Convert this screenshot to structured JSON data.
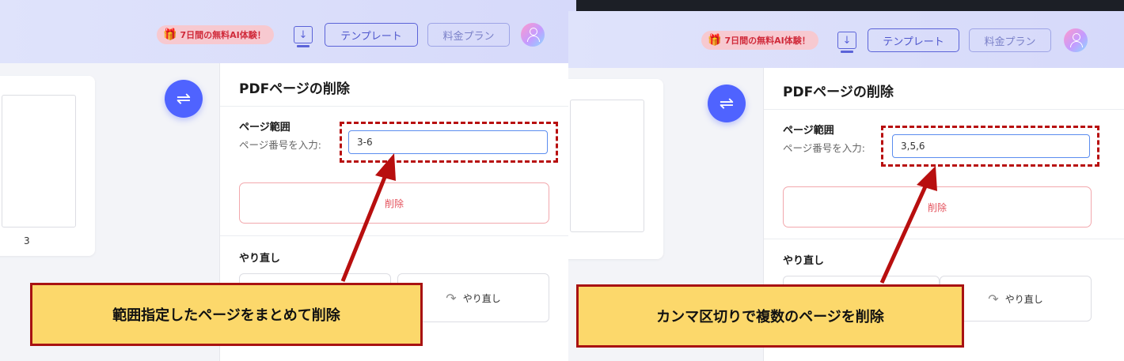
{
  "header": {
    "promo_label": "7日間の無料AI体験！",
    "download_label": "↓",
    "template_button": "テンプレート",
    "pricing_button": "料金プラン"
  },
  "thumbnail": {
    "page_number": "3"
  },
  "swap_symbol": "⇌",
  "right_panel": {
    "title": "PDFページの削除",
    "page_range_label": "ページ範囲",
    "page_input_label": "ページ番号を入力:",
    "delete_button": "削除",
    "redo_section_label": "やり直し",
    "redo_button": "やり直し"
  },
  "left_example": {
    "input_value": "3-6",
    "callout": "範囲指定したページをまとめて削除"
  },
  "right_example": {
    "input_value": "3,5,6",
    "callout": "カンマ区切りで複数のページを削除"
  },
  "colors": {
    "accent": "#4f63ff",
    "highlight_border": "#b80f0f",
    "callout_fill": "#fcd86b",
    "delete_text": "#e4505b"
  }
}
